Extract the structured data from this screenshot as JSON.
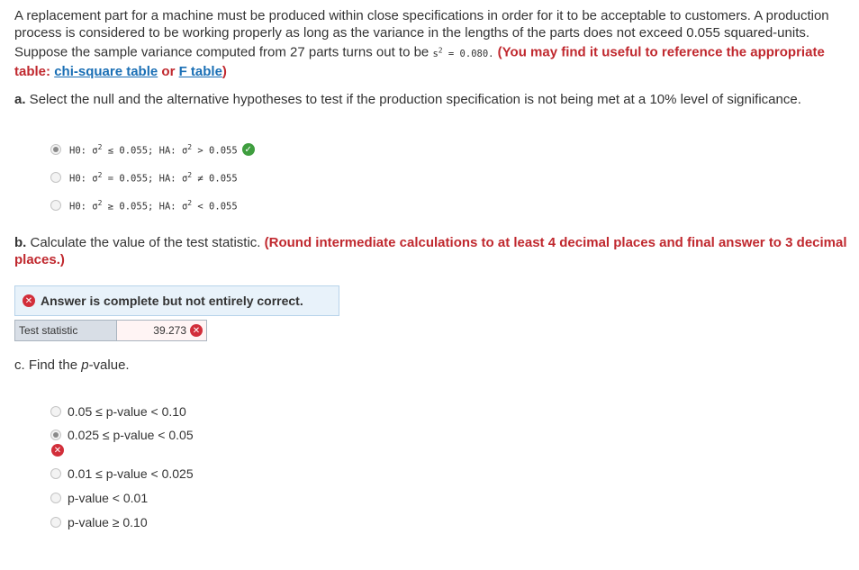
{
  "intro": {
    "text1": "A replacement part for a machine must be produced within close specifications in order for it to be acceptable to customers. A production process is considered to be working properly as long as the variance in the lengths of the parts does not exceed 0.055 squared-units. Suppose the sample variance computed from 27 parts turns out to be ",
    "s": "s",
    "sq": "2",
    "svalue": " = 0.080.",
    "ref_prefix": " (You may find it useful to reference the appropriate table: ",
    "link1": "chi-square table",
    "or": " or ",
    "link2": "F table",
    "ref_suffix": ")"
  },
  "part_a": {
    "label": "a.",
    "question": " Select the null and the alternative hypotheses to test if the production specification is not being met at a 10% level of significance.",
    "options": [
      {
        "h0": "H0: σ",
        "h0sq": "2",
        "h0rest": " ≤ 0.055; HA: σ",
        "hasq": "2",
        "harest": " > 0.055",
        "selected": true,
        "status": "correct"
      },
      {
        "h0": "H0: σ",
        "h0sq": "2",
        "h0rest": " = 0.055; HA: σ",
        "hasq": "2",
        "harest": " ≠ 0.055",
        "selected": false
      },
      {
        "h0": "H0: σ",
        "h0sq": "2",
        "h0rest": " ≥ 0.055; HA: σ",
        "hasq": "2",
        "harest": " < 0.055",
        "selected": false
      }
    ]
  },
  "part_b": {
    "label": "b.",
    "question": " Calculate the value of the test statistic.",
    "instruction": " (Round intermediate calculations to at least 4 decimal places and final answer to 3 decimal places.)",
    "banner": "Answer is complete but not entirely correct.",
    "stat_label": "Test statistic",
    "stat_value": "39.273"
  },
  "part_c": {
    "label": "c.",
    "question_pre": " Find the ",
    "question_em": "p",
    "question_post": "-value.",
    "options": [
      {
        "text": "0.05 ≤ p-value < 0.10",
        "selected": false
      },
      {
        "text": "0.025 ≤ p-value < 0.05",
        "selected": true,
        "status": "incorrect"
      },
      {
        "text": "0.01 ≤ p-value < 0.025",
        "selected": false
      },
      {
        "text": "p-value < 0.01",
        "selected": false
      },
      {
        "text": "p-value ≥ 0.10",
        "selected": false
      }
    ]
  },
  "colors": {
    "correct": "#3f9e3f",
    "incorrect": "#d22e3a",
    "accent_red": "#c0282e",
    "link": "#1a6fb5"
  },
  "icons": {
    "correct": "check-circle-icon",
    "incorrect": "x-circle-icon"
  }
}
